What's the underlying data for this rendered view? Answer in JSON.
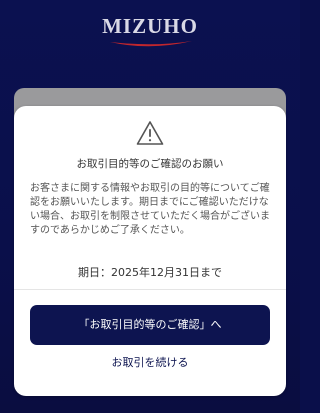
{
  "header": {
    "logo_text": "MIZUHO"
  },
  "dialog": {
    "icon": "warning-triangle-icon",
    "title": "お取引目的等のご確認のお願い",
    "body": "お客さまに関する情報やお取引の目的等についてご確認をお願いいたします。期日までにご確認いただけない場合、お取引を制限させていただく場合がございますのであらかじめご了承ください。",
    "deadline": "期日：2025年12月31日まで",
    "confirm_label": "「お取引目的等のご確認」へ",
    "continue_label": "お取引を続ける"
  },
  "colors": {
    "background": "#0a0f4a",
    "primary_button": "#0d1450",
    "logo_accent": "#c0262d"
  }
}
